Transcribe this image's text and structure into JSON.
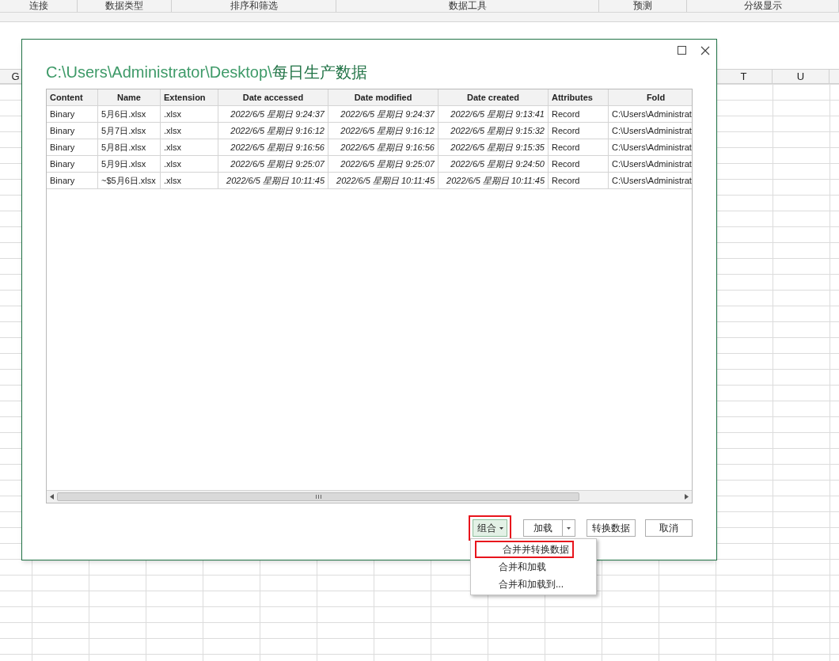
{
  "ribbon_groups": [
    "连接",
    "数据类型",
    "排序和筛选",
    "数据工具",
    "预测",
    "分级显示"
  ],
  "sheet": {
    "column_headers": [
      {
        "label": "G"
      },
      {
        "label": "T"
      },
      {
        "label": "U"
      }
    ]
  },
  "dialog": {
    "path": "C:\\Users\\Administrator\\Desktop\\",
    "folder": "每日生产数据",
    "table": {
      "columns": [
        "Content",
        "Name",
        "Extension",
        "Date accessed",
        "Date modified",
        "Date created",
        "Attributes",
        "Fold"
      ],
      "rows": [
        [
          "Binary",
          "5月6日.xlsx",
          ".xlsx",
          "2022/6/5 星期日 9:24:37",
          "2022/6/5 星期日 9:24:37",
          "2022/6/5 星期日 9:13:41",
          "Record",
          "C:\\Users\\Administrat"
        ],
        [
          "Binary",
          "5月7日.xlsx",
          ".xlsx",
          "2022/6/5 星期日 9:16:12",
          "2022/6/5 星期日 9:16:12",
          "2022/6/5 星期日 9:15:32",
          "Record",
          "C:\\Users\\Administrat"
        ],
        [
          "Binary",
          "5月8日.xlsx",
          ".xlsx",
          "2022/6/5 星期日 9:16:56",
          "2022/6/5 星期日 9:16:56",
          "2022/6/5 星期日 9:15:35",
          "Record",
          "C:\\Users\\Administrat"
        ],
        [
          "Binary",
          "5月9日.xlsx",
          ".xlsx",
          "2022/6/5 星期日 9:25:07",
          "2022/6/5 星期日 9:25:07",
          "2022/6/5 星期日 9:24:50",
          "Record",
          "C:\\Users\\Administrat"
        ],
        [
          "Binary",
          "~$5月6日.xlsx",
          ".xlsx",
          "2022/6/5 星期日 10:11:45",
          "2022/6/5 星期日 10:11:45",
          "2022/6/5 星期日 10:11:45",
          "Record",
          "C:\\Users\\Administrat"
        ]
      ]
    },
    "combine_button": {
      "label": "组合",
      "pressed": true,
      "highlighted": true
    },
    "load_button": {
      "label": "加载"
    },
    "transform_button": {
      "label": "转换数据"
    },
    "cancel_button": {
      "label": "取消"
    },
    "combine_menu": [
      {
        "label": "合并并转换数据",
        "selected": true
      },
      {
        "label": "合并和加载",
        "selected": false
      },
      {
        "label": "合并和加载到...",
        "selected": false
      }
    ]
  }
}
